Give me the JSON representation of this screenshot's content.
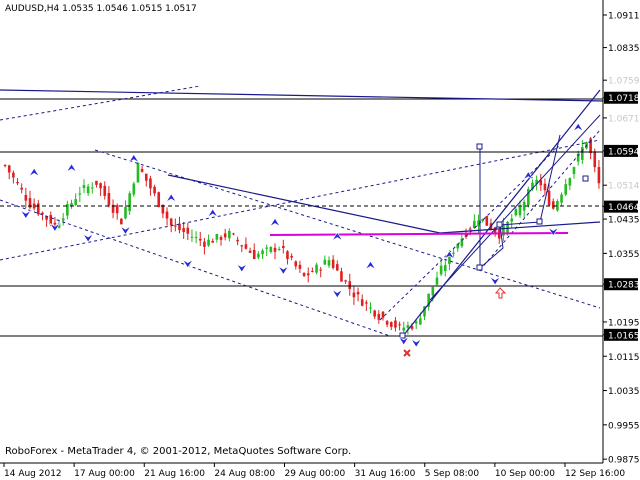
{
  "window": {
    "symbol_header": "AUDUSD,H4  1.0535 1.0546 1.0515 1.0517",
    "footer": "RoboForex - MetaTrader 4, © 2001-2012, MetaQuotes Software Corp."
  },
  "colors": {
    "background": "#ffffff",
    "bull_candle": "#22bb22",
    "bear_candle": "#e02020",
    "trend_lines": "#1a1a8c",
    "horizontal_lines": "#000000",
    "magenta_level": "#dd00dd",
    "fractal_arrows": "#2a2adb",
    "highlight_label": "#000000",
    "faded_label": "#c8c8c8",
    "signal_arrow_up": "#e03030",
    "signal_cross": "#e03030"
  },
  "chart_data": {
    "type": "candlestick",
    "timeframe": "H4",
    "ylim": [
      0.9866,
      1.0946
    ],
    "y_ticks": [
      "1.0911",
      "1.0835",
      "1.0759",
      "1.0718",
      "1.0671",
      "1.0594",
      "1.0514",
      "1.0464",
      "1.0435",
      "1.0355",
      "1.0283",
      "1.0195",
      "1.0165",
      "1.0115",
      "1.0035",
      "0.9955",
      "0.9875"
    ],
    "highlighted_levels": [
      "1.0718",
      "1.0594",
      "1.0464",
      "1.0283",
      "1.0165"
    ],
    "faded_levels": [
      "1.0759",
      "1.0671",
      "1.0514"
    ],
    "magenta_level": 1.0408,
    "x_tick_labels": [
      "14 Aug 2012",
      "17 Aug 00:00",
      "21 Aug 16:00",
      "24 Aug 08:00",
      "29 Aug 00:00",
      "31 Aug 16:00",
      "5 Sep 08:00",
      "10 Sep 00:00",
      "12 Sep 16:00"
    ],
    "anchors": [
      {
        "bar": 0,
        "price": 1.056
      },
      {
        "bar": 6,
        "price": 1.047
      },
      {
        "bar": 12,
        "price": 1.042
      },
      {
        "bar": 18,
        "price": 1.05
      },
      {
        "bar": 22,
        "price": 1.052
      },
      {
        "bar": 28,
        "price": 1.043
      },
      {
        "bar": 32,
        "price": 1.056
      },
      {
        "bar": 40,
        "price": 1.042
      },
      {
        "bar": 48,
        "price": 1.038
      },
      {
        "bar": 54,
        "price": 1.04
      },
      {
        "bar": 60,
        "price": 1.035
      },
      {
        "bar": 66,
        "price": 1.037
      },
      {
        "bar": 72,
        "price": 1.03
      },
      {
        "bar": 78,
        "price": 1.034
      },
      {
        "bar": 84,
        "price": 1.026
      },
      {
        "bar": 90,
        "price": 1.021
      },
      {
        "bar": 95,
        "price": 1.018
      },
      {
        "bar": 99,
        "price": 1.019
      },
      {
        "bar": 104,
        "price": 1.03
      },
      {
        "bar": 109,
        "price": 1.038
      },
      {
        "bar": 114,
        "price": 1.044
      },
      {
        "bar": 119,
        "price": 1.04
      },
      {
        "bar": 124,
        "price": 1.046
      },
      {
        "bar": 128,
        "price": 1.053
      },
      {
        "bar": 132,
        "price": 1.046
      },
      {
        "bar": 137,
        "price": 1.056
      },
      {
        "bar": 140,
        "price": 1.062
      },
      {
        "bar": 143,
        "price": 1.0517
      }
    ],
    "fractals_up": [
      {
        "bar": 7,
        "price": 1.0535
      },
      {
        "bar": 16,
        "price": 1.0545
      },
      {
        "bar": 31,
        "price": 1.0567
      },
      {
        "bar": 40,
        "price": 1.0475
      },
      {
        "bar": 50,
        "price": 1.044
      },
      {
        "bar": 65,
        "price": 1.0418
      },
      {
        "bar": 80,
        "price": 1.0385
      },
      {
        "bar": 88,
        "price": 1.0318
      },
      {
        "bar": 107,
        "price": 1.0342
      },
      {
        "bar": 126,
        "price": 1.0527
      },
      {
        "bar": 138,
        "price": 1.064
      }
    ],
    "fractals_down": [
      {
        "bar": 5,
        "price": 1.0455
      },
      {
        "bar": 12,
        "price": 1.0425
      },
      {
        "bar": 20,
        "price": 1.04
      },
      {
        "bar": 29,
        "price": 1.0418
      },
      {
        "bar": 44,
        "price": 1.034
      },
      {
        "bar": 57,
        "price": 1.033
      },
      {
        "bar": 67,
        "price": 1.0325
      },
      {
        "bar": 80,
        "price": 1.027
      },
      {
        "bar": 96,
        "price": 1.016
      },
      {
        "bar": 99,
        "price": 1.0155
      },
      {
        "bar": 118,
        "price": 1.03
      },
      {
        "bar": 132,
        "price": 1.0415
      }
    ]
  }
}
